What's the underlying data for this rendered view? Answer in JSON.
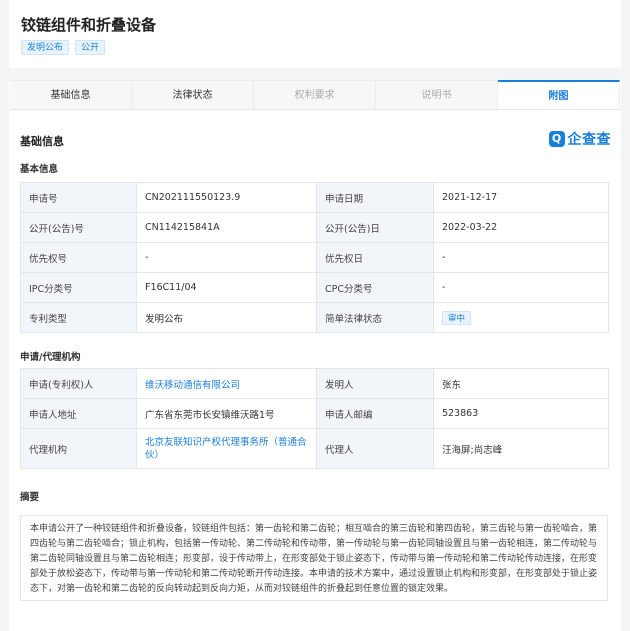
{
  "header": {
    "title": "铰链组件和折叠设备",
    "tags": [
      "发明公布",
      "公开"
    ]
  },
  "tabs": [
    {
      "label": "基础信息",
      "state": "normal"
    },
    {
      "label": "法律状态",
      "state": "normal"
    },
    {
      "label": "权利要求",
      "state": "disabled"
    },
    {
      "label": "说明书",
      "state": "disabled"
    },
    {
      "label": "附图",
      "state": "active"
    }
  ],
  "section": {
    "title": "基础信息",
    "logo_text": "企查查",
    "logo_mark": "Q"
  },
  "basic": {
    "subtitle": "基本信息",
    "rows": [
      {
        "l1": "申请号",
        "v1": "CN202111550123.9",
        "l2": "申请日期",
        "v2": "2021-12-17"
      },
      {
        "l1": "公开(公告)号",
        "v1": "CN114215841A",
        "l2": "公开(公告)日",
        "v2": "2022-03-22"
      },
      {
        "l1": "优先权号",
        "v1": "-",
        "l2": "优先权日",
        "v2": "-"
      },
      {
        "l1": "IPC分类号",
        "v1": "F16C11/04",
        "l2": "CPC分类号",
        "v2": "-"
      },
      {
        "l1": "专利类型",
        "v1": "发明公布",
        "l2": "简单法律状态",
        "v2": "审中"
      }
    ]
  },
  "agent": {
    "subtitle": "申请/代理机构",
    "rows": [
      {
        "l1": "申请(专利权)人",
        "v1": "维沃移动通信有限公司",
        "l2": "发明人",
        "v2": "张东"
      },
      {
        "l1": "申请人地址",
        "v1": "广东省东莞市长安镇维沃路1号",
        "l2": "申请人邮编",
        "v2": "523863"
      },
      {
        "l1": "代理机构",
        "v1": "北京友联知识产权代理事务所（普通合伙）",
        "l2": "代理人",
        "v2": "汪海屏;尚志峰"
      }
    ]
  },
  "abstract": {
    "title": "摘要",
    "text": "本申请公开了一种铰链组件和折叠设备，铰链组件包括：第一齿轮和第二齿轮；相互啮合的第三齿轮和第四齿轮，第三齿轮与第一齿轮啮合，第四齿轮与第二齿轮啮合；锁止机构，包括第一传动轮、第二传动轮和传动带，第一传动轮与第一齿轮同轴设置且与第一齿轮相连，第二传动轮与第二齿轮同轴设置且与第二齿轮相连；形变部，设于传动带上，在形变部处于锁止姿态下，传动带与第一传动轮和第二传动轮传动连接，在形变部处于放松姿态下，传动带与第一传动轮和第二传动轮断开传动连接。本申请的技术方案中，通过设置锁止机构和形变部，在形变部处于锁止姿态下，对第一齿轮和第二齿轮的反向转动起到反向力矩，从而对铰链组件的折叠起到任意位置的锁定效果。"
  }
}
